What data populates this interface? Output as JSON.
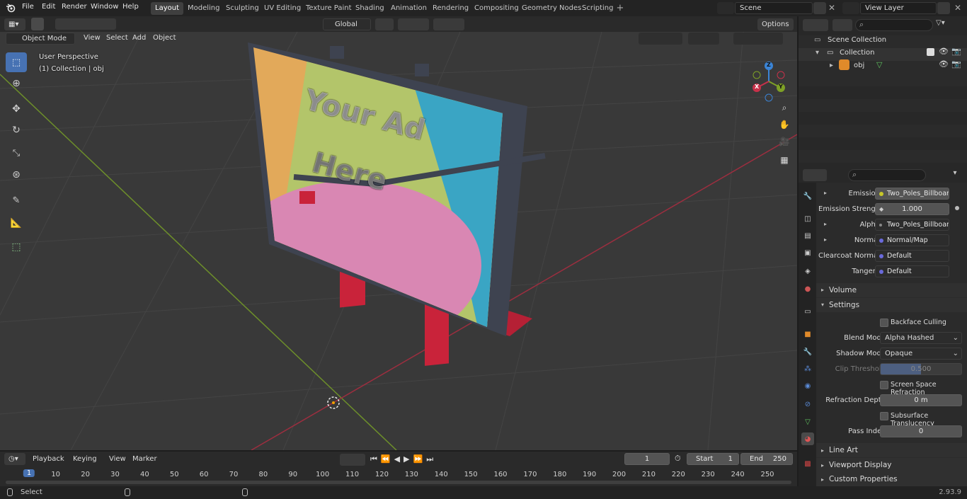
{
  "menus": [
    "File",
    "Edit",
    "Render",
    "Window",
    "Help"
  ],
  "workspaces": [
    "Layout",
    "Modeling",
    "Sculpting",
    "UV Editing",
    "Texture Paint",
    "Shading",
    "Animation",
    "Rendering",
    "Compositing",
    "Geometry Nodes",
    "Scripting"
  ],
  "scene": "Scene",
  "view_layer": "View Layer",
  "viewport": {
    "mode": "Object Mode",
    "menu": [
      "View",
      "Select",
      "Add",
      "Object"
    ],
    "orientation": "Global",
    "options": "Options",
    "perspective": "User Perspective",
    "collection_info": "(1) Collection | obj",
    "billboard_text": [
      "Your Ad",
      "Here"
    ],
    "gizmo": {
      "z": "Z",
      "y": "Y",
      "x": "X"
    }
  },
  "outliner": {
    "scene_collection": "Scene Collection",
    "collection": "Collection",
    "object": "obj"
  },
  "properties": {
    "emission_label": "Emission",
    "emission_value": "Two_Poles_Billboard...",
    "emission_strength_label": "Emission Strengt",
    "emission_strength_value": "1.000",
    "alpha_label": "Alpha",
    "alpha_value": "Two_Poles_Billboard...",
    "normal_label": "Normal",
    "normal_value": "Normal/Map",
    "clearcoat_label": "Clearcoat Normal",
    "clearcoat_value": "Default",
    "tangent_label": "Tangent",
    "tangent_value": "Default",
    "volume": "Volume",
    "settings": "Settings",
    "backface": "Backface Culling",
    "blend_mode_label": "Blend Mode",
    "blend_mode_value": "Alpha Hashed",
    "shadow_mode_label": "Shadow Mode",
    "shadow_mode_value": "Opaque",
    "clip_label": "Clip Threshold",
    "clip_value": "0.500",
    "ssr": "Screen Space Refraction",
    "refraction_label": "Refraction Depth",
    "refraction_value": "0 m",
    "subsurface": "Subsurface Translucency",
    "pass_label": "Pass Index",
    "pass_value": "0",
    "line_art": "Line Art",
    "viewport_display": "Viewport Display",
    "custom_props": "Custom Properties"
  },
  "timeline": {
    "menu": [
      "Playback",
      "Keying",
      "View",
      "Marker"
    ],
    "current_frame": "1",
    "start_label": "Start",
    "start_value": "1",
    "end_label": "End",
    "end_value": "250",
    "ticks": [
      "1",
      "10",
      "20",
      "30",
      "40",
      "50",
      "60",
      "70",
      "80",
      "90",
      "100",
      "110",
      "120",
      "130",
      "140",
      "150",
      "160",
      "170",
      "180",
      "190",
      "200",
      "210",
      "220",
      "230",
      "240",
      "250"
    ]
  },
  "status": {
    "select": "Select",
    "version": "2.93.9"
  },
  "colors": {
    "accent": "#4772b3",
    "x_axis": "#c8314a",
    "y_axis": "#7ea126",
    "z_axis": "#3b84d6"
  }
}
